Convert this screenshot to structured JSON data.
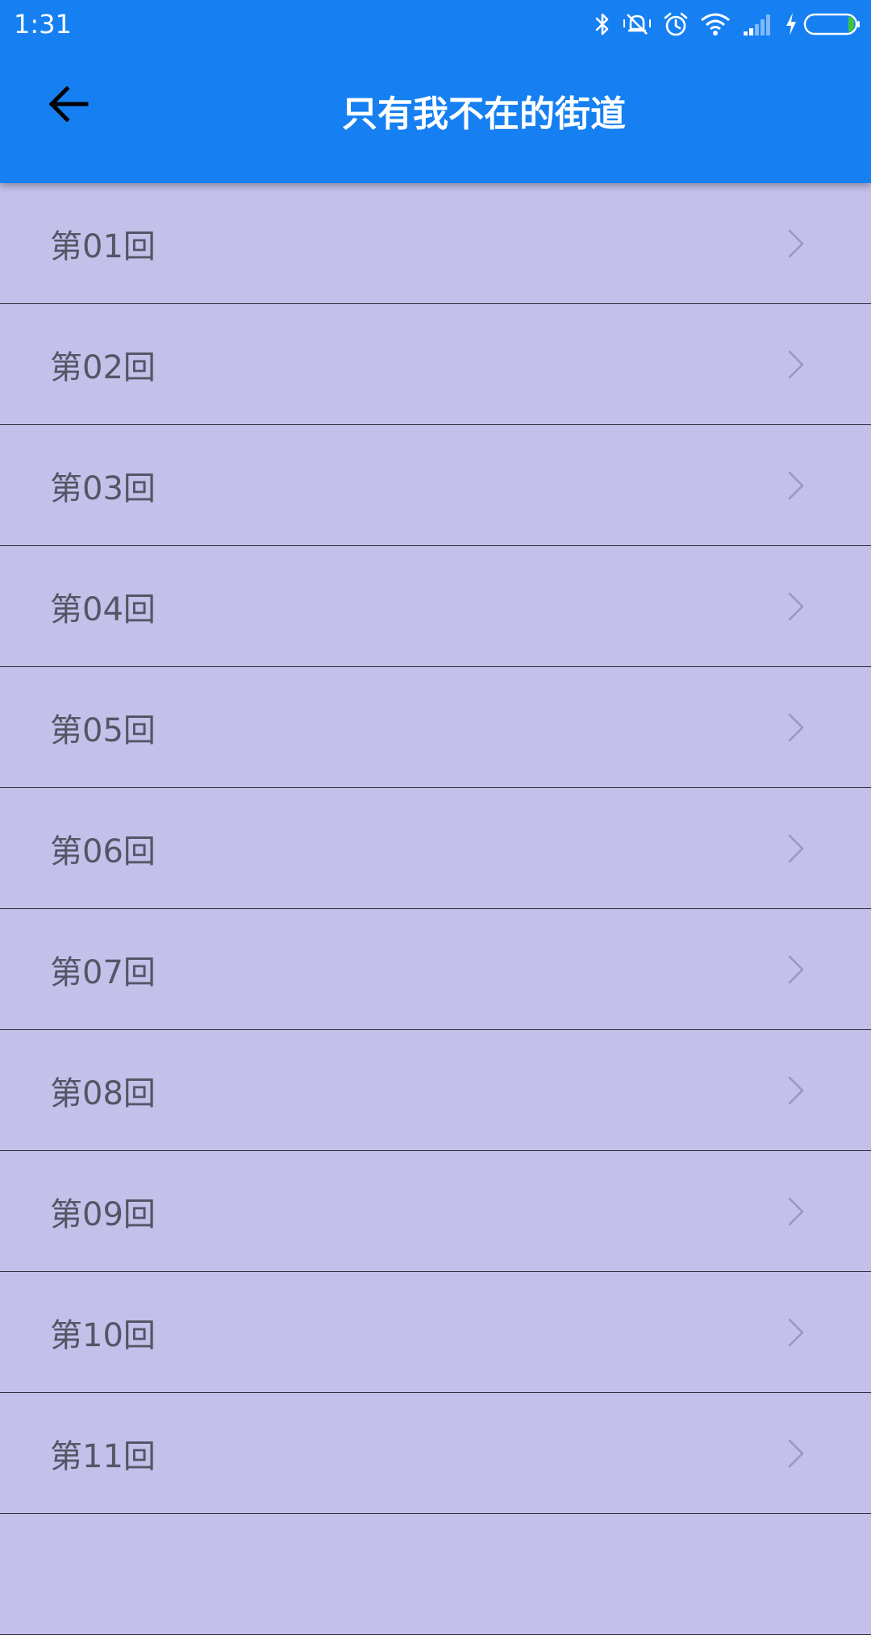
{
  "status_bar": {
    "time": "1:31",
    "icons": [
      "bluetooth-icon",
      "vibrate-icon",
      "alarm-icon",
      "wifi-icon",
      "signal-icon",
      "charging-icon",
      "battery-icon"
    ]
  },
  "header": {
    "title": "只有我不在的街道",
    "back_icon": "back-arrow-icon"
  },
  "colors": {
    "primary": "#1680f2",
    "list_background": "#c3c1ea",
    "divider": "#2d2b3a",
    "item_text": "#555566",
    "chevron": "#9a98c0"
  },
  "episodes": [
    {
      "label": "第01回"
    },
    {
      "label": "第02回"
    },
    {
      "label": "第03回"
    },
    {
      "label": "第04回"
    },
    {
      "label": "第05回"
    },
    {
      "label": "第06回"
    },
    {
      "label": "第07回"
    },
    {
      "label": "第08回"
    },
    {
      "label": "第09回"
    },
    {
      "label": "第10回"
    },
    {
      "label": "第11回"
    },
    {
      "label": ""
    }
  ]
}
